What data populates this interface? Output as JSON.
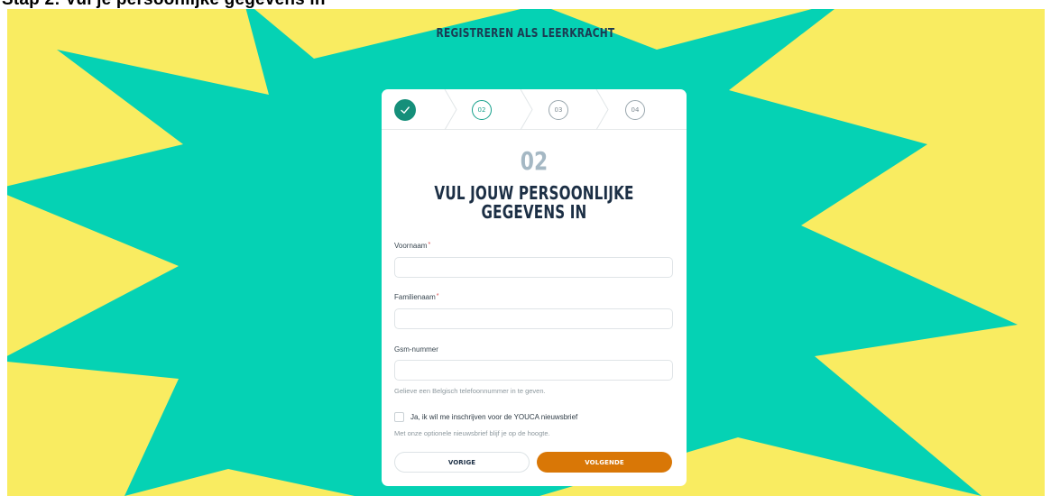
{
  "header": {
    "cropped_text": "Stap 2: Vul je persoonlijke gegevens in",
    "page_heading": "REGISTREREN ALS LEERKRACHT"
  },
  "colors": {
    "background_yellow": "#f9ec61",
    "burst_teal": "#05d2b4",
    "primary_button": "#d97706",
    "active_step": "#15a08b",
    "heading": "#1c2f45"
  },
  "stepper": {
    "steps": [
      {
        "label": "",
        "state": "completed",
        "icon": "check-icon"
      },
      {
        "label": "02",
        "state": "active"
      },
      {
        "label": "03",
        "state": "upcoming"
      },
      {
        "label": "04",
        "state": "upcoming"
      }
    ]
  },
  "card": {
    "step_number": "02",
    "title_line1": "VUL JOUW PERSOONLIJKE",
    "title_line2": "GEGEVENS IN"
  },
  "form": {
    "first_name": {
      "label": "Voornaam",
      "required_mark": "*",
      "value": ""
    },
    "last_name": {
      "label": "Familienaam",
      "required_mark": "*",
      "value": ""
    },
    "phone": {
      "label": "Gsm-nummer",
      "value": "",
      "hint": "Gelieve een Belgisch telefoonnummer in te geven."
    },
    "newsletter": {
      "checked": false,
      "label": "Ja, ik wil me inschrijven voor de YOUCA nieuwsbrief",
      "hint": "Met onze optionele nieuwsbrief blijf je op de hoogte."
    }
  },
  "buttons": {
    "previous": "VORIGE",
    "next": "VOLGENDE"
  }
}
